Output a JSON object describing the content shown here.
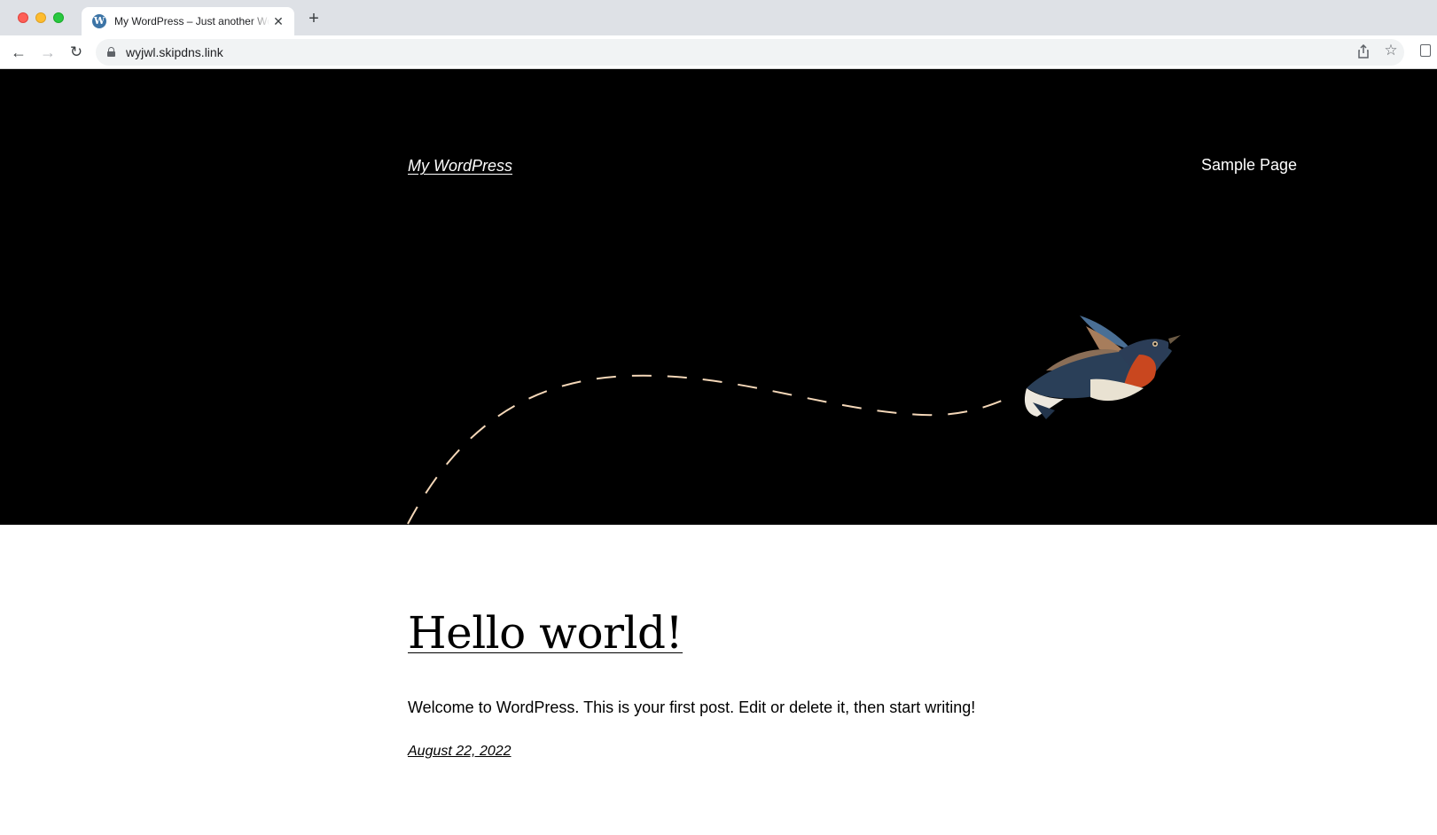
{
  "browser": {
    "tab": {
      "title": "My WordPress – Just another WordPress site",
      "favicon_icon": "wordpress-logo-icon",
      "favicon_glyph": "W",
      "close_glyph": "✕"
    },
    "new_tab_glyph": "+",
    "nav": {
      "back_glyph": "←",
      "forward_glyph": "→",
      "reload_glyph": "↻"
    },
    "url": "wyjwl.skipdns.link",
    "star_glyph": "☆"
  },
  "site": {
    "title": "My WordPress",
    "nav_items": [
      "Sample Page"
    ],
    "hero_background": "#000000",
    "path_color": "#f4d7b8"
  },
  "post": {
    "title": "Hello world!",
    "excerpt": "Welcome to WordPress. This is your first post. Edit or delete it, then start writing!",
    "date": "August 22, 2022"
  }
}
